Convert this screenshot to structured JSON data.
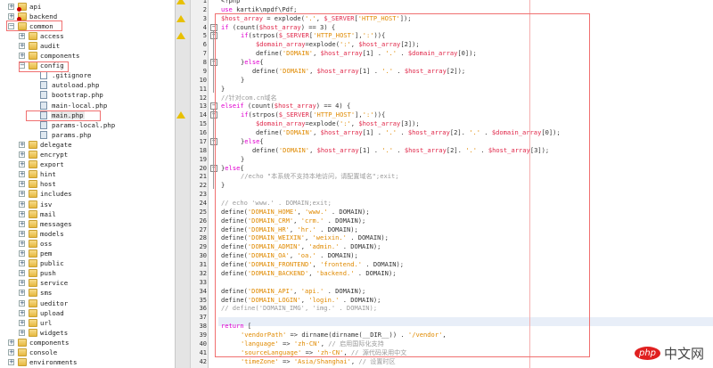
{
  "tree": [
    {
      "label": "api",
      "level": 0,
      "kind": "folder-red",
      "exp": "+"
    },
    {
      "label": "backend",
      "level": 0,
      "kind": "folder-red",
      "exp": "+"
    },
    {
      "label": "common",
      "level": 0,
      "kind": "folder",
      "exp": "-"
    },
    {
      "label": "access",
      "level": 1,
      "kind": "folder",
      "exp": "+"
    },
    {
      "label": "audit",
      "level": 1,
      "kind": "folder",
      "exp": "+"
    },
    {
      "label": "components",
      "level": 1,
      "kind": "folder",
      "exp": "+"
    },
    {
      "label": "config",
      "level": 1,
      "kind": "folder",
      "exp": "-"
    },
    {
      "label": ".gitignore",
      "level": 2,
      "kind": "file-plain"
    },
    {
      "label": "autoload.php",
      "level": 2,
      "kind": "file"
    },
    {
      "label": "bootstrap.php",
      "level": 2,
      "kind": "file"
    },
    {
      "label": "main-local.php",
      "level": 2,
      "kind": "file"
    },
    {
      "label": "main.php",
      "level": 2,
      "kind": "file",
      "selected": true
    },
    {
      "label": "params-local.php",
      "level": 2,
      "kind": "file"
    },
    {
      "label": "params.php",
      "level": 2,
      "kind": "file"
    },
    {
      "label": "delegate",
      "level": 1,
      "kind": "folder",
      "exp": "+"
    },
    {
      "label": "encrypt",
      "level": 1,
      "kind": "folder",
      "exp": "+"
    },
    {
      "label": "export",
      "level": 1,
      "kind": "folder",
      "exp": "+"
    },
    {
      "label": "hint",
      "level": 1,
      "kind": "folder",
      "exp": "+"
    },
    {
      "label": "host",
      "level": 1,
      "kind": "folder",
      "exp": "+"
    },
    {
      "label": "includes",
      "level": 1,
      "kind": "folder",
      "exp": "+"
    },
    {
      "label": "isv",
      "level": 1,
      "kind": "folder",
      "exp": "+"
    },
    {
      "label": "mail",
      "level": 1,
      "kind": "folder",
      "exp": "+"
    },
    {
      "label": "messages",
      "level": 1,
      "kind": "folder",
      "exp": "+"
    },
    {
      "label": "models",
      "level": 1,
      "kind": "folder",
      "exp": "+"
    },
    {
      "label": "oss",
      "level": 1,
      "kind": "folder",
      "exp": "+"
    },
    {
      "label": "pem",
      "level": 1,
      "kind": "folder",
      "exp": "+"
    },
    {
      "label": "public",
      "level": 1,
      "kind": "folder",
      "exp": "+"
    },
    {
      "label": "push",
      "level": 1,
      "kind": "folder",
      "exp": "+"
    },
    {
      "label": "service",
      "level": 1,
      "kind": "folder",
      "exp": "+"
    },
    {
      "label": "sms",
      "level": 1,
      "kind": "folder",
      "exp": "+"
    },
    {
      "label": "ueditor",
      "level": 1,
      "kind": "folder",
      "exp": "+"
    },
    {
      "label": "upload",
      "level": 1,
      "kind": "folder",
      "exp": "+"
    },
    {
      "label": "url",
      "level": 1,
      "kind": "folder",
      "exp": "+"
    },
    {
      "label": "widgets",
      "level": 1,
      "kind": "folder",
      "exp": "+"
    },
    {
      "label": "components",
      "level": 0,
      "kind": "folder",
      "exp": "+"
    },
    {
      "label": "console",
      "level": 0,
      "kind": "folder",
      "exp": "+"
    },
    {
      "label": "environments",
      "level": 0,
      "kind": "folder",
      "exp": "+"
    }
  ],
  "code": [
    {
      "n": "1",
      "i": 0,
      "t": [
        [
          "df",
          "<?php"
        ]
      ]
    },
    {
      "n": "2",
      "i": 0,
      "t": [
        [
          "kw",
          "use"
        ],
        [
          "df",
          " kartik\\mpdf\\Pdf;"
        ]
      ]
    },
    {
      "n": "3",
      "i": 0,
      "t": [
        [
          "var",
          "$host_array"
        ],
        [
          "df",
          " = explode("
        ],
        [
          "str",
          "'.'"
        ],
        [
          "df",
          ", "
        ],
        [
          "var",
          "$_SERVER"
        ],
        [
          "df",
          "["
        ],
        [
          "str",
          "'HTTP_HOST'"
        ],
        [
          "df",
          "]);"
        ]
      ]
    },
    {
      "n": "4",
      "i": 0,
      "t": [
        [
          "kw",
          "if"
        ],
        [
          "df",
          " (count("
        ],
        [
          "var",
          "$host_array"
        ],
        [
          "df",
          ") == 3) {"
        ]
      ]
    },
    {
      "n": "5",
      "i": 1,
      "t": [
        [
          "kw",
          "if"
        ],
        [
          "df",
          "(strpos("
        ],
        [
          "var",
          "$_SERVER"
        ],
        [
          "df",
          "["
        ],
        [
          "str",
          "'HTTP_HOST'"
        ],
        [
          "df",
          "],"
        ],
        [
          "str",
          "':'"
        ],
        [
          "df",
          ")){"
        ]
      ]
    },
    {
      "n": "6",
      "i": 2,
      "t": [
        [
          "var",
          "$domain_array"
        ],
        [
          "df",
          "=explode("
        ],
        [
          "str",
          "':'"
        ],
        [
          "df",
          ", "
        ],
        [
          "var",
          "$host_array"
        ],
        [
          "df",
          "[2]);"
        ]
      ]
    },
    {
      "n": "7",
      "i": 2,
      "t": [
        [
          "df",
          "define("
        ],
        [
          "str",
          "'DOMAIN'"
        ],
        [
          "df",
          ", "
        ],
        [
          "var",
          "$host_array"
        ],
        [
          "df",
          "[1] . "
        ],
        [
          "str",
          "'.'"
        ],
        [
          "df",
          " . "
        ],
        [
          "var",
          "$domain_array"
        ],
        [
          "df",
          "[0]);"
        ]
      ]
    },
    {
      "n": "8",
      "i": 1,
      "t": [
        [
          "df",
          "}"
        ],
        [
          "kw",
          "else"
        ],
        [
          "df",
          "{"
        ]
      ]
    },
    {
      "n": "9",
      "i": 1.7,
      "t": [
        [
          "df",
          "define("
        ],
        [
          "str",
          "'DOMAIN'"
        ],
        [
          "df",
          ", "
        ],
        [
          "var",
          "$host_array"
        ],
        [
          "df",
          "[1] . "
        ],
        [
          "str",
          "'.'"
        ],
        [
          "df",
          " . "
        ],
        [
          "var",
          "$host_array"
        ],
        [
          "df",
          "[2]);"
        ]
      ]
    },
    {
      "n": "10",
      "i": 1,
      "t": [
        [
          "df",
          "}"
        ]
      ]
    },
    {
      "n": "11",
      "i": 0,
      "t": [
        [
          "df",
          "}"
        ]
      ]
    },
    {
      "n": "12",
      "i": 0,
      "t": [
        [
          "cm",
          "//针对com.cn域名"
        ]
      ]
    },
    {
      "n": "13",
      "i": 0,
      "t": [
        [
          "kw",
          "elseif"
        ],
        [
          "df",
          " (count("
        ],
        [
          "var",
          "$host_array"
        ],
        [
          "df",
          ") == 4) {"
        ]
      ]
    },
    {
      "n": "14",
      "i": 1,
      "t": [
        [
          "kw",
          "if"
        ],
        [
          "df",
          "(strpos("
        ],
        [
          "var",
          "$_SERVER"
        ],
        [
          "df",
          "["
        ],
        [
          "str",
          "'HTTP_HOST'"
        ],
        [
          "df",
          "],"
        ],
        [
          "str",
          "':'"
        ],
        [
          "df",
          ")){"
        ]
      ]
    },
    {
      "n": "15",
      "i": 2,
      "t": [
        [
          "var",
          "$domain_array"
        ],
        [
          "df",
          "=explode("
        ],
        [
          "str",
          "':'"
        ],
        [
          "df",
          ", "
        ],
        [
          "var",
          "$host_array"
        ],
        [
          "df",
          "[3]);"
        ]
      ]
    },
    {
      "n": "16",
      "i": 2,
      "t": [
        [
          "df",
          "define("
        ],
        [
          "str",
          "'DOMAIN'"
        ],
        [
          "df",
          ", "
        ],
        [
          "var",
          "$host_array"
        ],
        [
          "df",
          "[1] . "
        ],
        [
          "str",
          "'.'"
        ],
        [
          "df",
          " . "
        ],
        [
          "var",
          "$host_array"
        ],
        [
          "df",
          "[2]. "
        ],
        [
          "str",
          "'.'"
        ],
        [
          "df",
          " . "
        ],
        [
          "var",
          "$domain_array"
        ],
        [
          "df",
          "[0]);"
        ]
      ]
    },
    {
      "n": "17",
      "i": 1,
      "t": [
        [
          "df",
          "}"
        ],
        [
          "kw",
          "else"
        ],
        [
          "df",
          "{"
        ]
      ]
    },
    {
      "n": "18",
      "i": 1.7,
      "t": [
        [
          "df",
          "define("
        ],
        [
          "str",
          "'DOMAIN'"
        ],
        [
          "df",
          ", "
        ],
        [
          "var",
          "$host_array"
        ],
        [
          "df",
          "[1] . "
        ],
        [
          "str",
          "'.'"
        ],
        [
          "df",
          " . "
        ],
        [
          "var",
          "$host_array"
        ],
        [
          "df",
          "[2]. "
        ],
        [
          "str",
          "'.'"
        ],
        [
          "df",
          " . "
        ],
        [
          "var",
          "$host_array"
        ],
        [
          "df",
          "[3]);"
        ]
      ]
    },
    {
      "n": "19",
      "i": 1,
      "t": [
        [
          "df",
          "}"
        ]
      ]
    },
    {
      "n": "20",
      "i": 0,
      "t": [
        [
          "df",
          "}"
        ],
        [
          "kw",
          "else"
        ],
        [
          "df",
          "{"
        ]
      ]
    },
    {
      "n": "21",
      "i": 1,
      "t": [
        [
          "cm",
          "//echo \"本系统不支持本地访问，请配置域名\";exit;"
        ]
      ]
    },
    {
      "n": "22",
      "i": 0,
      "t": [
        [
          "df",
          "}"
        ]
      ]
    },
    {
      "n": "23",
      "i": 0,
      "t": []
    },
    {
      "n": "24",
      "i": 0,
      "t": [
        [
          "cm",
          "// echo 'www.' . DOMAIN;exit;"
        ]
      ]
    },
    {
      "n": "25",
      "i": 0,
      "t": [
        [
          "df",
          "define("
        ],
        [
          "str",
          "'DOMAIN_HOME'"
        ],
        [
          "df",
          ", "
        ],
        [
          "str",
          "'www.'"
        ],
        [
          "df",
          " . DOMAIN);"
        ]
      ]
    },
    {
      "n": "26",
      "i": 0,
      "t": [
        [
          "df",
          "define("
        ],
        [
          "str",
          "'DOMAIN_CRM'"
        ],
        [
          "df",
          ", "
        ],
        [
          "str",
          "'crm.'"
        ],
        [
          "df",
          " . DOMAIN);"
        ]
      ]
    },
    {
      "n": "27",
      "i": 0,
      "t": [
        [
          "df",
          "define("
        ],
        [
          "str",
          "'DOMAIN_HR'"
        ],
        [
          "df",
          ", "
        ],
        [
          "str",
          "'hr.'"
        ],
        [
          "df",
          " . DOMAIN);"
        ]
      ]
    },
    {
      "n": "28",
      "i": 0,
      "t": [
        [
          "df",
          "define("
        ],
        [
          "str",
          "'DOMAIN_WEIXIN'"
        ],
        [
          "df",
          ", "
        ],
        [
          "str",
          "'weixin.'"
        ],
        [
          "df",
          " . DOMAIN);"
        ]
      ]
    },
    {
      "n": "29",
      "i": 0,
      "t": [
        [
          "df",
          "define("
        ],
        [
          "str",
          "'DOMAIN_ADMIN'"
        ],
        [
          "df",
          ", "
        ],
        [
          "str",
          "'admin.'"
        ],
        [
          "df",
          " . DOMAIN);"
        ]
      ]
    },
    {
      "n": "30",
      "i": 0,
      "t": [
        [
          "df",
          "define("
        ],
        [
          "str",
          "'DOMAIN_OA'"
        ],
        [
          "df",
          ", "
        ],
        [
          "str",
          "'oa.'"
        ],
        [
          "df",
          " . DOMAIN);"
        ]
      ]
    },
    {
      "n": "31",
      "i": 0,
      "t": [
        [
          "df",
          "define("
        ],
        [
          "str",
          "'DOMAIN_FRONTEND'"
        ],
        [
          "df",
          ", "
        ],
        [
          "str",
          "'frontend.'"
        ],
        [
          "df",
          " . DOMAIN);"
        ]
      ]
    },
    {
      "n": "32",
      "i": 0,
      "t": [
        [
          "df",
          "define("
        ],
        [
          "str",
          "'DOMAIN_BACKEND'"
        ],
        [
          "df",
          ", "
        ],
        [
          "str",
          "'backend.'"
        ],
        [
          "df",
          " . DOMAIN);"
        ]
      ]
    },
    {
      "n": "33",
      "i": 0,
      "t": []
    },
    {
      "n": "34",
      "i": 0,
      "t": [
        [
          "df",
          "define("
        ],
        [
          "str",
          "'DOMAIN_API'"
        ],
        [
          "df",
          ", "
        ],
        [
          "str",
          "'api.'"
        ],
        [
          "df",
          " . DOMAIN);"
        ]
      ]
    },
    {
      "n": "35",
      "i": 0,
      "t": [
        [
          "df",
          "define("
        ],
        [
          "str",
          "'DOMAIN_LOGIN'"
        ],
        [
          "df",
          ", "
        ],
        [
          "str",
          "'login.'"
        ],
        [
          "df",
          " . DOMAIN);"
        ]
      ]
    },
    {
      "n": "36",
      "i": 0,
      "t": [
        [
          "cm",
          "// define('DOMAIN_IMG', 'img.' . DOMAIN);"
        ]
      ]
    },
    {
      "n": "37",
      "i": 0,
      "t": []
    },
    {
      "n": "38",
      "i": 0,
      "t": [
        [
          "kw",
          "return"
        ],
        [
          "df",
          " ["
        ]
      ]
    },
    {
      "n": "39",
      "i": 1,
      "t": [
        [
          "str",
          "'vendorPath'"
        ],
        [
          "df",
          " => dirname(dirname(__DIR__)) . "
        ],
        [
          "str",
          "'/vendor'"
        ],
        [
          "df",
          ","
        ]
      ]
    },
    {
      "n": "40",
      "i": 1,
      "t": [
        [
          "str",
          "'language'"
        ],
        [
          "df",
          " => "
        ],
        [
          "str",
          "'zh-CN'"
        ],
        [
          "df",
          ", "
        ],
        [
          "cm",
          "// 启用国际化支持"
        ]
      ]
    },
    {
      "n": "41",
      "i": 1,
      "t": [
        [
          "str",
          "'sourceLanguage'"
        ],
        [
          "df",
          " => "
        ],
        [
          "str",
          "'zh-CN'"
        ],
        [
          "df",
          ", "
        ],
        [
          "cm",
          "// 源代码采用中文"
        ]
      ]
    },
    {
      "n": "42",
      "i": 1,
      "t": [
        [
          "str",
          "'timeZone'"
        ],
        [
          "df",
          " => "
        ],
        [
          "str",
          "'Asia/Shanghai'"
        ],
        [
          "df",
          ", "
        ],
        [
          "cm",
          "// 设置时区"
        ]
      ]
    }
  ],
  "warnings": [
    "1",
    "3",
    "5",
    "14"
  ],
  "folds": [
    "4",
    "5",
    "8",
    "13",
    "14",
    "17",
    "20"
  ],
  "watermark": {
    "logo": "php",
    "text": "中文网"
  }
}
